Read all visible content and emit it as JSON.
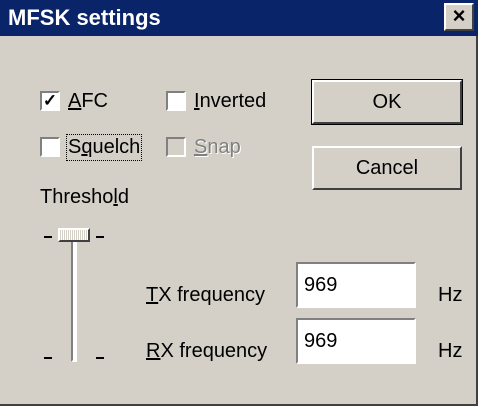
{
  "window": {
    "title": "MFSK settings",
    "close_glyph": "×"
  },
  "checkboxes": {
    "afc": {
      "label_accel": "A",
      "label_rest": "FC",
      "checked": true
    },
    "inverted": {
      "label_accel": "I",
      "label_rest": "nverted",
      "checked": false
    },
    "squelch": {
      "label_pre": "S",
      "label_accel": "q",
      "label_rest": "uelch",
      "checked": false
    },
    "snap": {
      "label_accel": "S",
      "label_rest": "nap",
      "checked": false,
      "enabled": false
    }
  },
  "buttons": {
    "ok": "OK",
    "cancel": "Cancel"
  },
  "threshold": {
    "label_pre": "Thresho",
    "label_accel": "l",
    "label_rest": "d",
    "level": 1.0
  },
  "tx": {
    "label_accel": "T",
    "label_rest": "X frequency",
    "value": "969",
    "unit": "Hz"
  },
  "rx": {
    "label_accel": "R",
    "label_rest": "X frequency",
    "value": "969",
    "unit": "Hz"
  },
  "check_glyph": "✓"
}
